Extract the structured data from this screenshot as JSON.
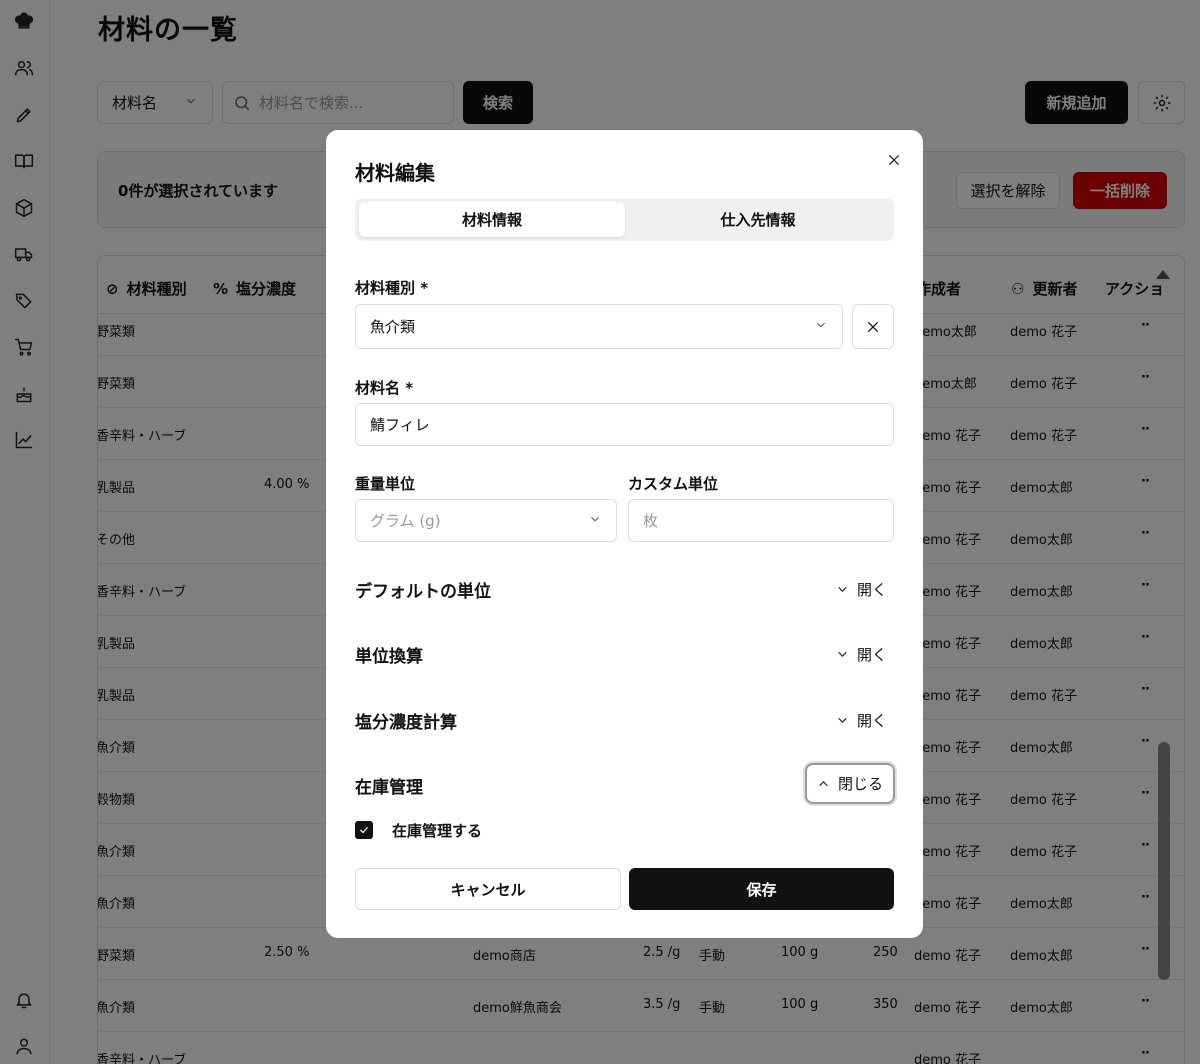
{
  "page": {
    "title": "材料の一覧",
    "filter_select": "材料名",
    "search_placeholder": "材料名で検索...",
    "search_button": "検索",
    "new_button": "新規追加",
    "selection_count": "0件が選択されています",
    "deselect_button": "選択を解除",
    "bulk_delete_button": "一括削除"
  },
  "sidebar_icons": [
    "chef-hat-icon",
    "users-icon",
    "pen-icon",
    "book-icon",
    "box-icon",
    "truck-icon",
    "tags-icon",
    "cart-icon",
    "cake-icon",
    "chart-icon",
    "bell-icon",
    "user-icon"
  ],
  "table": {
    "headers": {
      "category": "材料種別",
      "salt": "塩分濃度",
      "creator": "作成者",
      "updater": "更新者",
      "action": "アクショ"
    },
    "rows": [
      {
        "category": "野菜類",
        "salt": "",
        "supplier": "",
        "price": "",
        "mode": "",
        "qty": "",
        "total": "",
        "creator": "demo太郎",
        "updater": "demo 花子"
      },
      {
        "category": "野菜類",
        "salt": "",
        "supplier": "",
        "price": "",
        "mode": "",
        "qty": "",
        "total": "",
        "creator": "demo太郎",
        "updater": "demo 花子"
      },
      {
        "category": "香辛料・ハーブ",
        "salt": "",
        "supplier": "",
        "price": "",
        "mode": "",
        "qty": "",
        "total": "",
        "creator": "demo 花子",
        "updater": "demo 花子"
      },
      {
        "category": "乳製品",
        "salt": "4.00 %",
        "supplier": "",
        "price": "",
        "mode": "",
        "qty": "",
        "total": "",
        "creator": "demo 花子",
        "updater": "demo太郎"
      },
      {
        "category": "その他",
        "salt": "",
        "supplier": "",
        "price": "",
        "mode": "",
        "qty": "",
        "total": "",
        "creator": "demo 花子",
        "updater": "demo太郎"
      },
      {
        "category": "香辛料・ハーブ",
        "salt": "",
        "supplier": "",
        "price": "",
        "mode": "",
        "qty": "",
        "total": "",
        "creator": "demo 花子",
        "updater": "demo太郎"
      },
      {
        "category": "乳製品",
        "salt": "",
        "supplier": "",
        "price": "",
        "mode": "",
        "qty": "",
        "total": "",
        "creator": "demo 花子",
        "updater": "demo太郎"
      },
      {
        "category": "乳製品",
        "salt": "",
        "supplier": "",
        "price": "",
        "mode": "",
        "qty": "",
        "total": "",
        "creator": "demo 花子",
        "updater": "demo 花子"
      },
      {
        "category": "魚介類",
        "salt": "",
        "supplier": "",
        "price": "",
        "mode": "",
        "qty": "",
        "total": "",
        "creator": "demo 花子",
        "updater": "demo太郎"
      },
      {
        "category": "穀物類",
        "salt": "",
        "supplier": "",
        "price": "",
        "mode": "",
        "qty": "",
        "total": "",
        "creator": "demo 花子",
        "updater": "demo 花子"
      },
      {
        "category": "魚介類",
        "salt": "",
        "supplier": "",
        "price": "",
        "mode": "",
        "qty": "",
        "total": "",
        "creator": "demo 花子",
        "updater": "demo 花子"
      },
      {
        "category": "魚介類",
        "salt": "",
        "supplier": "",
        "price": "",
        "mode": "",
        "qty": "",
        "total": "",
        "creator": "demo 花子",
        "updater": "demo太郎"
      },
      {
        "category": "野菜類",
        "salt": "2.50 %",
        "supplier": "demo商店",
        "price": "2.5 /g",
        "mode": "手動",
        "qty": "100 g",
        "total": "250",
        "creator": "demo 花子",
        "updater": "demo太郎"
      },
      {
        "category": "魚介類",
        "salt": "",
        "supplier": "demo鮮魚商会",
        "price": "3.5 /g",
        "mode": "手動",
        "qty": "100 g",
        "total": "350",
        "creator": "demo 花子",
        "updater": "demo太郎"
      },
      {
        "category": "香辛料・ハーブ",
        "salt": "",
        "supplier": "",
        "price": "",
        "mode": "",
        "qty": "",
        "total": "",
        "creator": "demo 花子",
        "updater": ""
      }
    ]
  },
  "modal": {
    "title": "材料編集",
    "tab_info": "材料情報",
    "tab_supplier": "仕入先情報",
    "category_label": "材料種別 *",
    "category_value": "魚介類",
    "name_label": "材料名 *",
    "name_value": "鯖フィレ",
    "weight_unit_label": "重量単位",
    "weight_unit_value": "グラム (g)",
    "custom_unit_label": "カスタム単位",
    "custom_unit_placeholder": "枚",
    "sections": {
      "default_unit": "デフォルトの単位",
      "unit_conversion": "単位換算",
      "salt_calc": "塩分濃度計算",
      "inventory": "在庫管理"
    },
    "open_label": "開く",
    "close_label": "閉じる",
    "inventory_checkbox_label": "在庫管理する",
    "inventory_checked": true,
    "cancel_button": "キャンセル",
    "save_button": "保存"
  }
}
